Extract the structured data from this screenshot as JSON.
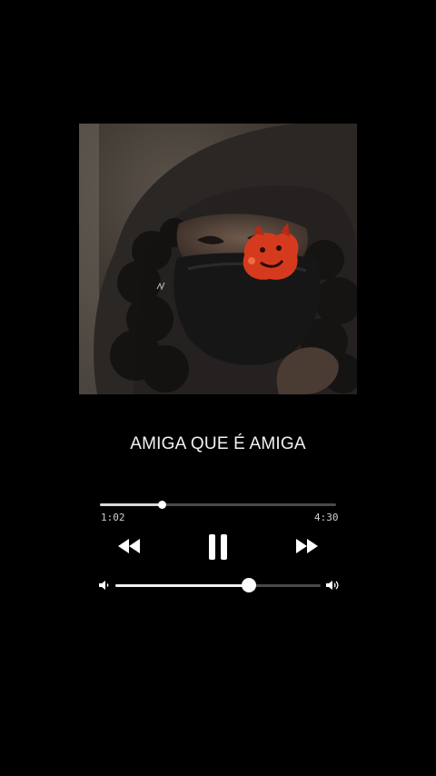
{
  "track": {
    "title": "AMIGA QUE É AMIGA",
    "cover_icon": "album-art-image"
  },
  "playback": {
    "elapsed": "1:02",
    "total": "4:30",
    "progress_fraction": 0.26,
    "state": "playing"
  },
  "controls": {
    "rewind_icon": "rewind-icon",
    "pause_icon": "pause-icon",
    "forward_icon": "fast-forward-icon"
  },
  "volume": {
    "level_fraction": 0.65,
    "low_icon": "volume-low-icon",
    "high_icon": "volume-high-icon"
  },
  "colors": {
    "background": "#000000",
    "text": "#f2f2f2",
    "track": "#4a4a4a",
    "fill": "#e0e0e0",
    "accent_red": "#d63a1e"
  }
}
